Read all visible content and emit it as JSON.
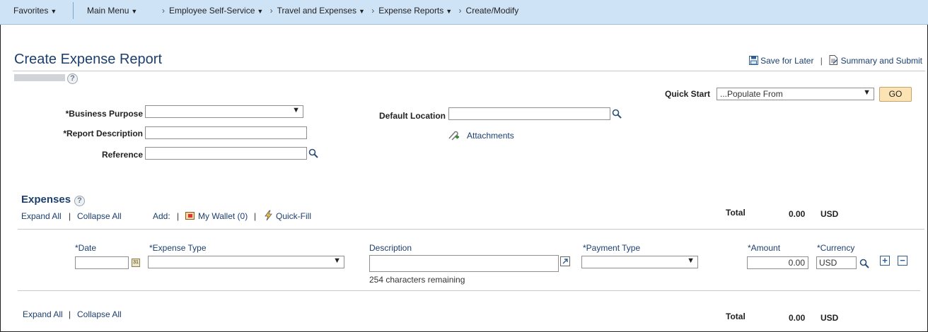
{
  "nav": {
    "favorites": "Favorites",
    "main_menu": "Main Menu",
    "breadcrumbs": [
      "Employee Self-Service",
      "Travel and Expenses",
      "Expense Reports",
      "Create/Modify"
    ]
  },
  "page": {
    "title": "Create Expense Report",
    "save_for_later": "Save for Later",
    "summary_submit": "Summary and Submit",
    "help": "?"
  },
  "header": {
    "quick_start_label": "Quick Start",
    "quick_start_value": "...Populate From",
    "go": "GO",
    "business_purpose_label": "*Business Purpose",
    "business_purpose_value": "",
    "report_description_label": "*Report Description",
    "report_description_value": "",
    "reference_label": "Reference",
    "reference_value": "",
    "default_location_label": "Default Location",
    "default_location_value": "",
    "attachments": "Attachments"
  },
  "expenses": {
    "title": "Expenses",
    "expand_all": "Expand All",
    "collapse_all": "Collapse All",
    "add_label": "Add:",
    "my_wallet": "My Wallet (0)",
    "quick_fill": "Quick-Fill",
    "total_label": "Total",
    "total_value": "0.00",
    "total_currency": "USD",
    "columns": {
      "date": "*Date",
      "expense_type": "*Expense Type",
      "description": "Description",
      "payment_type": "*Payment Type",
      "amount": "*Amount",
      "currency": "*Currency"
    },
    "row": {
      "date": "",
      "expense_type": "",
      "description": "",
      "chars_remaining": "254 characters remaining",
      "payment_type": "",
      "amount": "0.00",
      "currency": "USD"
    }
  },
  "icons": {
    "save": "floppy-disk-icon",
    "summary": "document-icon",
    "search": "magnifier-icon",
    "attach": "paperclip-icon",
    "wallet": "wallet-icon",
    "quickfill": "lightning-icon",
    "calendar": "calendar-icon",
    "add_row": "plus-icon",
    "delete_row": "minus-icon"
  },
  "colors": {
    "topbar": "#cfe3f6",
    "link": "#1c3f6e",
    "go_button": "#fbe3b4"
  }
}
